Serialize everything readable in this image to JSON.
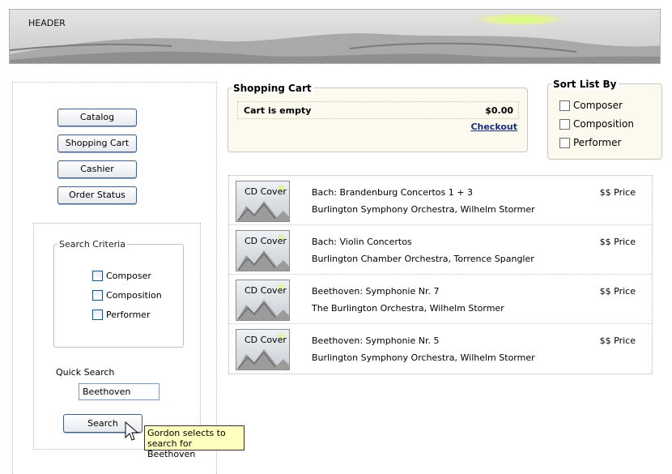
{
  "header": {
    "text": "HEADER"
  },
  "nav": {
    "items": [
      {
        "label": "Catalog"
      },
      {
        "label": "Shopping Cart"
      },
      {
        "label": "Cashier"
      },
      {
        "label": "Order Status"
      }
    ]
  },
  "search": {
    "criteria_title": "Search Criteria",
    "criteria": [
      {
        "label": "Composer",
        "checked": false
      },
      {
        "label": "Composition",
        "checked": false
      },
      {
        "label": "Performer",
        "checked": false
      }
    ],
    "quick_label": "Quick Search",
    "quick_value": "Beethoven",
    "button_label": "Search"
  },
  "cart": {
    "title": "Shopping Cart",
    "status": "Cart is empty",
    "total": "$0.00",
    "checkout_label": "Checkout"
  },
  "sort": {
    "title": "Sort List By",
    "options": [
      {
        "label": "Composer",
        "checked": false
      },
      {
        "label": "Composition",
        "checked": false
      },
      {
        "label": "Performer",
        "checked": false
      }
    ]
  },
  "results": [
    {
      "cover": "CD Cover",
      "title": "Bach: Brandenburg Concertos 1 + 3",
      "artist": "Burlington Symphony Orchestra, Wilhelm Stormer",
      "price": "$$ Price"
    },
    {
      "cover": "CD Cover",
      "title": "Bach: Violin Concertos",
      "artist": "Burlington Chamber Orchestra, Torrence Spangler",
      "price": "$$ Price"
    },
    {
      "cover": "CD Cover",
      "title": "Beethoven: Symphonie Nr. 7",
      "artist": "The Burlington Orchestra, Wilhelm Stormer",
      "price": "$$ Price"
    },
    {
      "cover": "CD Cover",
      "title": "Beethoven: Symphonie Nr. 5",
      "artist": "Burlington Symphony Orchestra, Wilhelm Stormer",
      "price": "$$ Price"
    }
  ],
  "tooltip": {
    "line1": "Gordon selects to",
    "line2": "search for Beethoven"
  },
  "colors": {
    "link": "#1a2d7a",
    "panel_bg": "#fcf9ee",
    "tooltip_bg": "#ffffc0",
    "button_border": "#3f5f86"
  }
}
